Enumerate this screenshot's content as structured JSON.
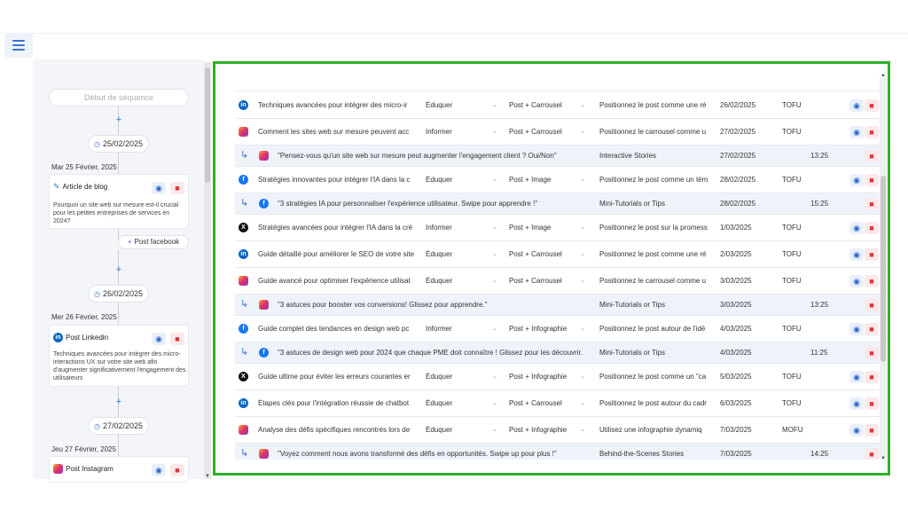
{
  "header": {
    "menu_icon": "hamburger-menu-icon"
  },
  "sequence": {
    "start_label": "Début de séquence",
    "add_symbol": "+",
    "groups": [
      {
        "date_pill": "25/02/2025",
        "day_label": "Mar 25 Février, 2025",
        "card_title": "Article de blog",
        "card_icon": "pen-icon",
        "card_desc": "Pourquoi un site web sur mesure est-il crucial pour les petites entreprises de services en 2024?"
      },
      {
        "date_pill": "26/02/2025",
        "day_label": "Mer 26 Février, 2025",
        "card_title": "Post Linkedin",
        "card_icon": "linkedin-icon",
        "card_desc": "Techniques avancées pour intégrer des micro-interactions UX sur votre site web afin d'augmenter significativement l'engagement des utilisateurs"
      },
      {
        "date_pill": "27/02/2025",
        "day_label": "Jeu 27 Février, 2025",
        "card_title": "Post Instagram",
        "card_icon": "instagram-icon",
        "card_desc": ""
      }
    ],
    "post_facebook_label": "Post facebook"
  },
  "table": {
    "rows": [
      {
        "kind": "post",
        "network": "linkedin",
        "title": "Techniques avancées pour intégrer des micro-ir",
        "objective": "Éduquer",
        "format": "Post + Carrousel",
        "angle": "Positionnez le post comme une ré",
        "date": "26/02/2025",
        "funnel": "TOFU"
      },
      {
        "kind": "post",
        "network": "instagram",
        "title": "Comment les sites web sur mesure peuvent acc",
        "objective": "Informer",
        "format": "Post + Carrousel",
        "angle": "Positionnez le carrousel comme u",
        "date": "27/02/2025",
        "funnel": "TOFU"
      },
      {
        "kind": "sub",
        "network": "instagram",
        "text": "\"Pensez-vous qu'un site web sur mesure peut augmenter l'engagement client ? Oui/Non\"",
        "category": "Interactive Stories",
        "date": "27/02/2025",
        "time": "13:25"
      },
      {
        "kind": "post",
        "network": "facebook",
        "title": "Stratégies innovantes pour intégrer l'IA dans la c",
        "objective": "Éduquer",
        "format": "Post + Image",
        "angle": "Positionnez le post comme un tém",
        "date": "28/02/2025",
        "funnel": "TOFU"
      },
      {
        "kind": "sub",
        "network": "facebook",
        "text": "\"3 stratégies IA pour personnaliser l'expérience utilisateur. Swipe pour apprendre !\"",
        "category": "Mini-Tutorials or Tips",
        "date": "28/02/2025",
        "time": "15:25"
      },
      {
        "kind": "post",
        "network": "x",
        "title": "Stratégies avancées pour intégrer l'IA dans la cré",
        "objective": "Informer",
        "format": "Post + Image",
        "angle": "Positionnez le post sur la promess",
        "date": "1/03/2025",
        "funnel": "TOFU"
      },
      {
        "kind": "post",
        "network": "linkedin",
        "title": "Guide détaillé pour améliorer le SEO de votre site",
        "objective": "Éduquer",
        "format": "Post + Carrousel",
        "angle": "Positionnez le post comme une ré",
        "date": "2/03/2025",
        "funnel": "TOFU"
      },
      {
        "kind": "post",
        "network": "instagram",
        "title": "Guide avancé pour optimiser l'expérience utilisat",
        "objective": "Éduquer",
        "format": "Post + Carrousel",
        "angle": "Positionnez le carrousel comme u",
        "date": "3/03/2025",
        "funnel": "TOFU"
      },
      {
        "kind": "sub",
        "network": "instagram",
        "text": "\"3 astuces pour booster vos conversions! Glissez pour apprendre.\"",
        "category": "Mini-Tutorials or Tips",
        "date": "3/03/2025",
        "time": "13:25"
      },
      {
        "kind": "post",
        "network": "facebook",
        "title": "Guide complet des tendances en design web pc",
        "objective": "Informer",
        "format": "Post + Infographie",
        "angle": "Positionnez le post autour de l'idé",
        "date": "4/03/2025",
        "funnel": "TOFU"
      },
      {
        "kind": "sub",
        "network": "facebook",
        "text": "\"3 astuces de design web pour 2024 que chaque PME doit connaître ! Glissez pour les découvrir.",
        "category": "Mini-Tutorials or Tips",
        "date": "4/03/2025",
        "time": "11:25"
      },
      {
        "kind": "post",
        "network": "x",
        "title": "Guide ultime pour éviter les erreurs courantes er",
        "objective": "Éduquer",
        "format": "Post + Infographie",
        "angle": "Positionnez le post comme un \"ca",
        "date": "5/03/2025",
        "funnel": "TOFU"
      },
      {
        "kind": "post",
        "network": "linkedin",
        "title": "Étapes clés pour l'intégration réussie de chatbot",
        "objective": "Éduquer",
        "format": "Post + Carrousel",
        "angle": "Positionnez le post autour du cadr",
        "date": "6/03/2025",
        "funnel": "TOFU"
      },
      {
        "kind": "post",
        "network": "instagram",
        "title": "Analyse des défis spécifiques rencontrés lors de",
        "objective": "Éduquer",
        "format": "Post + Infographie",
        "angle": "Utilisez une infographie dynamiq",
        "date": "7/03/2025",
        "funnel": "MOFU"
      },
      {
        "kind": "sub",
        "network": "instagram",
        "text": "\"Voyez comment nous avons transformé des défis en opportunités. Swipe up pour plus !\"",
        "category": "Behind-the-Scenes Stories",
        "date": "7/03/2025",
        "time": "14:25"
      }
    ]
  },
  "colors": {
    "accent": "#3b73d6",
    "frame": "#2fae2a",
    "delete": "#d9363e",
    "sub_row_bg": "#eef3fa"
  }
}
